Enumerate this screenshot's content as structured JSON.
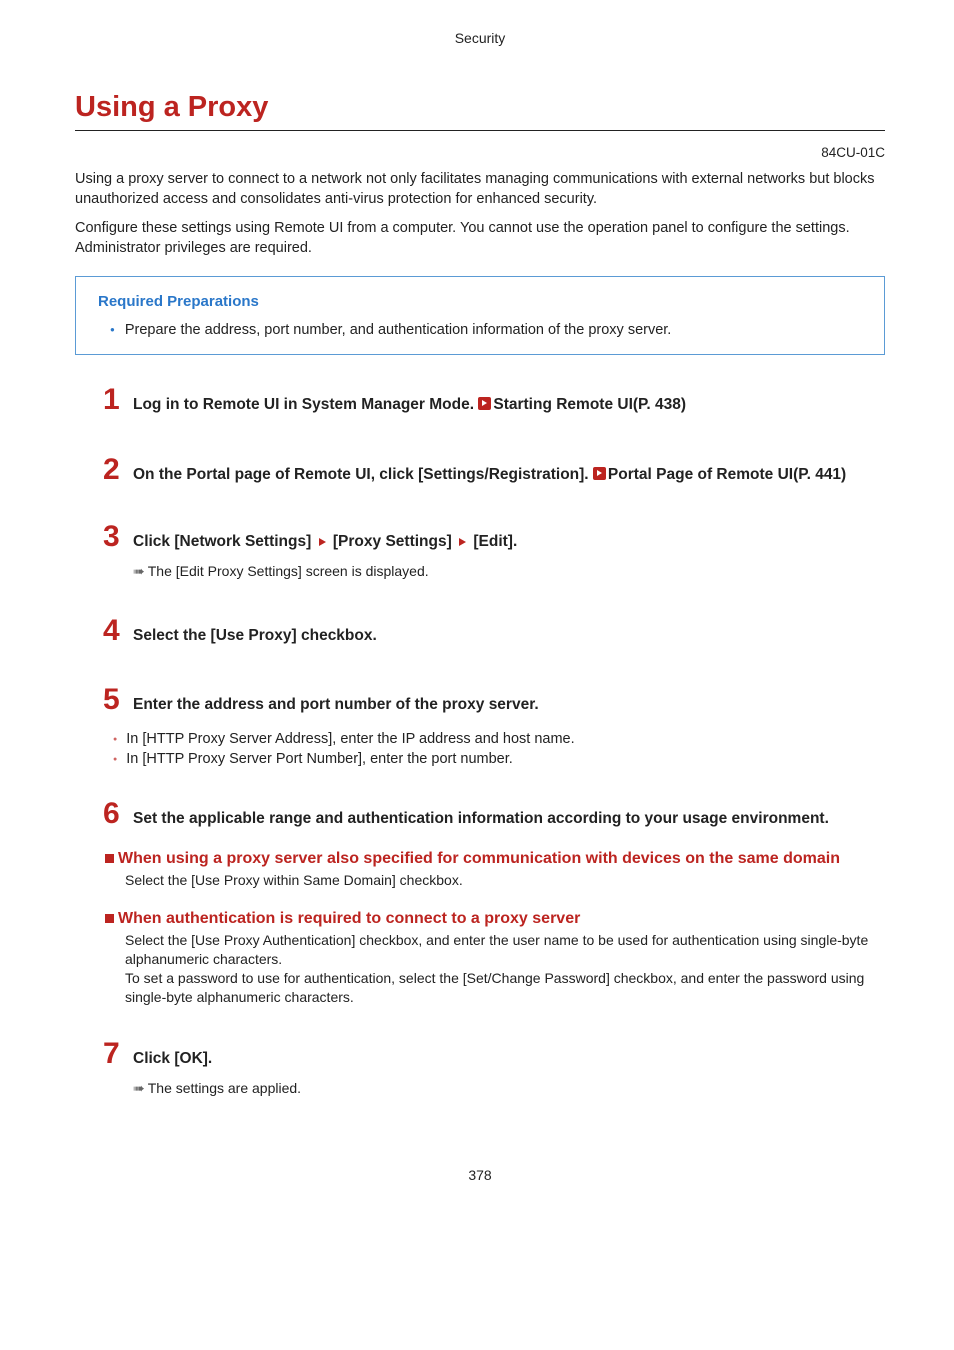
{
  "header": {
    "category": "Security"
  },
  "title": "Using a Proxy",
  "doc_code": "84CU-01C",
  "intro": {
    "p1": "Using a proxy server to connect to a network not only facilitates managing communications with external networks but blocks unauthorized access and consolidates anti-virus protection for enhanced security.",
    "p2": "Configure these settings using Remote UI from a computer. You cannot use the operation panel to configure the settings.",
    "p3": "Administrator privileges are required."
  },
  "prep": {
    "title": "Required Preparations",
    "items": [
      "Prepare the address, port number, and authentication information of the proxy server."
    ]
  },
  "steps": {
    "s1": {
      "num": "1",
      "text_a": "Log in to Remote UI in System Manager Mode. ",
      "link": "Starting Remote UI(P. 438)"
    },
    "s2": {
      "num": "2",
      "text_a": "On the Portal page of Remote UI, click [Settings/Registration]. ",
      "link": "Portal Page of Remote UI(P. 441)"
    },
    "s3": {
      "num": "3",
      "seg1": "Click [Network Settings] ",
      "seg2": " [Proxy Settings] ",
      "seg3": " [Edit].",
      "result": "The [Edit Proxy Settings] screen is displayed."
    },
    "s4": {
      "num": "4",
      "text": "Select the [Use Proxy] checkbox."
    },
    "s5": {
      "num": "5",
      "text": "Enter the address and port number of the proxy server.",
      "bullets": [
        "In [HTTP Proxy Server Address], enter the IP address and host name.",
        "In [HTTP Proxy Server Port Number], enter the port number."
      ]
    },
    "s6": {
      "num": "6",
      "text": "Set the applicable range and authentication information according to your usage environment.",
      "sub1": {
        "head": "When using a proxy server also specified for communication with devices on the same domain",
        "body": "Select the [Use Proxy within Same Domain] checkbox."
      },
      "sub2": {
        "head": "When authentication is required to connect to a proxy server",
        "body1": "Select the [Use Proxy Authentication] checkbox, and enter the user name to be used for authentication using single-byte alphanumeric characters.",
        "body2": "To set a password to use for authentication, select the [Set/Change Password] checkbox, and enter the password using single-byte alphanumeric characters."
      }
    },
    "s7": {
      "num": "7",
      "text": "Click [OK].",
      "result": "The settings are applied."
    }
  },
  "page_number": "378"
}
